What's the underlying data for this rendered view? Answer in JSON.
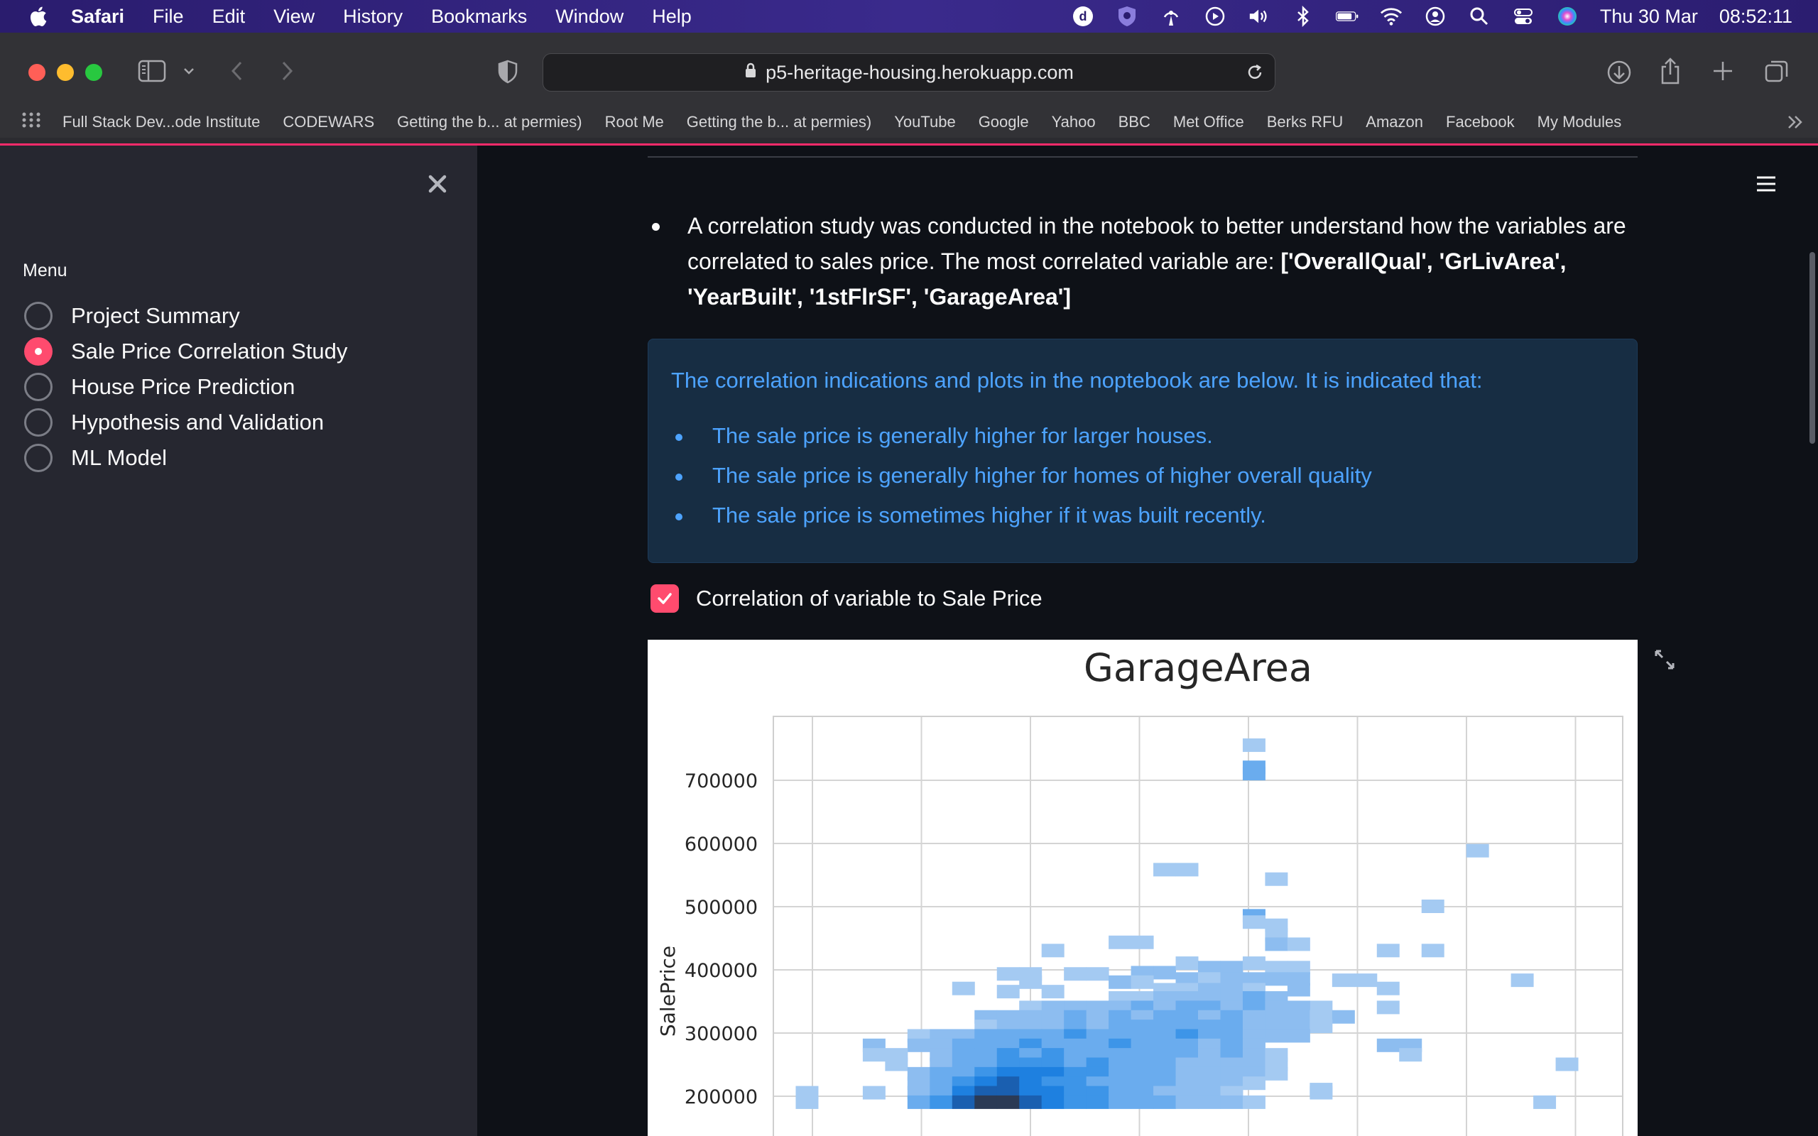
{
  "menubar": {
    "app": "Safari",
    "items": [
      "File",
      "Edit",
      "View",
      "History",
      "Bookmarks",
      "Window",
      "Help"
    ],
    "date": "Thu 30 Mar",
    "time": "08:52:11"
  },
  "browser": {
    "url": "p5-heritage-housing.herokuapp.com",
    "bookmarks": [
      "Full Stack Dev...ode Institute",
      "CODEWARS",
      "Getting the b... at permies)",
      "Root Me",
      "Getting the b... at permies)",
      "YouTube",
      "Google",
      "Yahoo",
      "BBC",
      "Met Office",
      "Berks RFU",
      "Amazon",
      "Facebook",
      "My Modules"
    ]
  },
  "sidebar": {
    "menu_title": "Menu",
    "items": [
      {
        "label": "Project Summary",
        "selected": false
      },
      {
        "label": "Sale Price Correlation Study",
        "selected": true
      },
      {
        "label": "House Price Prediction",
        "selected": false
      },
      {
        "label": "Hypothesis and Validation",
        "selected": false
      },
      {
        "label": "ML Model",
        "selected": false
      }
    ]
  },
  "main": {
    "bullet_text": "A correlation study was conducted in the notebook to better understand how the variables are correlated to sales price. The most correlated variable are: ",
    "bullet_bold": "['OverallQual', 'GrLivArea', 'YearBuilt', '1stFlrSF', 'GarageArea']",
    "info_intro": "The correlation indications and plots in the noptebook are below. It is indicated that:",
    "info_items": [
      "The sale price is generally higher for larger houses.",
      "The sale price is generally higher for homes of higher overall quality",
      "The sale price is sometimes higher if it was built recently."
    ],
    "checkbox_label": "Correlation of variable to Sale Price",
    "checkbox_checked": true
  },
  "chart_data": {
    "type": "heatmap",
    "title": "GarageArea",
    "xlabel": "",
    "ylabel": "SalePrice",
    "yticks": [
      200000,
      300000,
      400000,
      500000,
      600000,
      700000
    ],
    "ylim": [
      190000,
      785000
    ],
    "x_bins": 38,
    "cells": [
      [
        21,
        755000,
        0.35
      ],
      [
        21,
        720000,
        0.5
      ],
      [
        21,
        710000,
        0.5
      ],
      [
        31,
        588000,
        0.35
      ],
      [
        17,
        558000,
        0.35
      ],
      [
        18,
        558000,
        0.35
      ],
      [
        22,
        543000,
        0.35
      ],
      [
        21,
        485000,
        0.5
      ],
      [
        21,
        475000,
        0.35
      ],
      [
        22,
        470000,
        0.35
      ],
      [
        22,
        455000,
        0.35
      ],
      [
        22,
        440000,
        0.45
      ],
      [
        23,
        440000,
        0.35
      ],
      [
        29,
        500000,
        0.35
      ],
      [
        15,
        443000,
        0.35
      ],
      [
        16,
        443000,
        0.35
      ],
      [
        12,
        430000,
        0.35
      ],
      [
        27,
        430000,
        0.35
      ],
      [
        29,
        430000,
        0.35
      ],
      [
        33,
        383000,
        0.35
      ],
      [
        25,
        383000,
        0.35
      ],
      [
        26,
        383000,
        0.35
      ],
      [
        8,
        370000,
        0.35
      ],
      [
        27,
        370000,
        0.35
      ],
      [
        27,
        340000,
        0.35
      ],
      [
        24,
        340000,
        0.35
      ],
      [
        10,
        393000,
        0.35
      ],
      [
        11,
        393000,
        0.35
      ],
      [
        13,
        393000,
        0.35
      ],
      [
        14,
        393000,
        0.35
      ],
      [
        16,
        395000,
        0.4
      ],
      [
        17,
        395000,
        0.4
      ],
      [
        18,
        410000,
        0.35
      ],
      [
        19,
        403000,
        0.4
      ],
      [
        20,
        403000,
        0.4
      ],
      [
        21,
        410000,
        0.35
      ],
      [
        22,
        403000,
        0.35
      ],
      [
        23,
        403000,
        0.35
      ],
      [
        11,
        380000,
        0.35
      ],
      [
        15,
        380000,
        0.4
      ],
      [
        16,
        380000,
        0.35
      ],
      [
        18,
        385000,
        0.4
      ],
      [
        19,
        385000,
        0.35
      ],
      [
        20,
        385000,
        0.45
      ],
      [
        21,
        385000,
        0.4
      ],
      [
        22,
        385000,
        0.4
      ],
      [
        23,
        385000,
        0.4
      ],
      [
        10,
        365000,
        0.35
      ],
      [
        12,
        365000,
        0.35
      ],
      [
        17,
        368000,
        0.35
      ],
      [
        18,
        368000,
        0.35
      ],
      [
        19,
        368000,
        0.4
      ],
      [
        20,
        368000,
        0.4
      ],
      [
        21,
        368000,
        0.35
      ],
      [
        23,
        368000,
        0.4
      ],
      [
        15,
        355000,
        0.35
      ],
      [
        16,
        355000,
        0.35
      ],
      [
        17,
        355000,
        0.4
      ],
      [
        18,
        355000,
        0.4
      ],
      [
        19,
        355000,
        0.45
      ],
      [
        20,
        355000,
        0.4
      ],
      [
        21,
        355000,
        0.5
      ],
      [
        22,
        355000,
        0.45
      ],
      [
        11,
        340000,
        0.35
      ],
      [
        12,
        340000,
        0.4
      ],
      [
        13,
        340000,
        0.45
      ],
      [
        14,
        340000,
        0.4
      ],
      [
        15,
        340000,
        0.45
      ],
      [
        16,
        340000,
        0.5
      ],
      [
        17,
        340000,
        0.45
      ],
      [
        18,
        340000,
        0.55
      ],
      [
        19,
        340000,
        0.5
      ],
      [
        20,
        340000,
        0.45
      ],
      [
        21,
        340000,
        0.5
      ],
      [
        22,
        340000,
        0.4
      ],
      [
        23,
        340000,
        0.4
      ],
      [
        9,
        325000,
        0.4
      ],
      [
        10,
        325000,
        0.4
      ],
      [
        11,
        325000,
        0.45
      ],
      [
        12,
        325000,
        0.4
      ],
      [
        13,
        325000,
        0.5
      ],
      [
        14,
        325000,
        0.45
      ],
      [
        15,
        325000,
        0.5
      ],
      [
        16,
        325000,
        0.45
      ],
      [
        17,
        325000,
        0.5
      ],
      [
        18,
        325000,
        0.55
      ],
      [
        19,
        325000,
        0.45
      ],
      [
        20,
        325000,
        0.5
      ],
      [
        21,
        325000,
        0.45
      ],
      [
        22,
        325000,
        0.45
      ],
      [
        23,
        325000,
        0.4
      ],
      [
        24,
        325000,
        0.35
      ],
      [
        25,
        325000,
        0.4
      ],
      [
        9,
        310000,
        0.35
      ],
      [
        10,
        310000,
        0.45
      ],
      [
        11,
        310000,
        0.4
      ],
      [
        12,
        310000,
        0.45
      ],
      [
        13,
        310000,
        0.5
      ],
      [
        14,
        310000,
        0.45
      ],
      [
        15,
        310000,
        0.5
      ],
      [
        16,
        310000,
        0.55
      ],
      [
        17,
        310000,
        0.5
      ],
      [
        18,
        310000,
        0.5
      ],
      [
        19,
        310000,
        0.55
      ],
      [
        20,
        310000,
        0.5
      ],
      [
        21,
        310000,
        0.45
      ],
      [
        22,
        310000,
        0.4
      ],
      [
        23,
        310000,
        0.45
      ],
      [
        24,
        310000,
        0.35
      ],
      [
        6,
        295000,
        0.35
      ],
      [
        7,
        295000,
        0.4
      ],
      [
        8,
        295000,
        0.45
      ],
      [
        9,
        295000,
        0.5
      ],
      [
        10,
        295000,
        0.5
      ],
      [
        11,
        295000,
        0.55
      ],
      [
        12,
        295000,
        0.5
      ],
      [
        13,
        295000,
        0.6
      ],
      [
        14,
        295000,
        0.55
      ],
      [
        15,
        295000,
        0.5
      ],
      [
        16,
        295000,
        0.55
      ],
      [
        17,
        295000,
        0.5
      ],
      [
        18,
        295000,
        0.6
      ],
      [
        19,
        295000,
        0.5
      ],
      [
        20,
        295000,
        0.55
      ],
      [
        21,
        295000,
        0.45
      ],
      [
        22,
        295000,
        0.4
      ],
      [
        23,
        295000,
        0.4
      ],
      [
        4,
        280000,
        0.4
      ],
      [
        6,
        280000,
        0.4
      ],
      [
        7,
        280000,
        0.45
      ],
      [
        8,
        280000,
        0.5
      ],
      [
        9,
        280000,
        0.55
      ],
      [
        10,
        280000,
        0.5
      ],
      [
        11,
        280000,
        0.6
      ],
      [
        12,
        280000,
        0.55
      ],
      [
        13,
        280000,
        0.5
      ],
      [
        14,
        280000,
        0.55
      ],
      [
        15,
        280000,
        0.6
      ],
      [
        16,
        280000,
        0.5
      ],
      [
        17,
        280000,
        0.55
      ],
      [
        18,
        280000,
        0.5
      ],
      [
        19,
        280000,
        0.45
      ],
      [
        20,
        280000,
        0.5
      ],
      [
        21,
        280000,
        0.45
      ],
      [
        27,
        280000,
        0.4
      ],
      [
        28,
        280000,
        0.4
      ],
      [
        4,
        265000,
        0.35
      ],
      [
        5,
        265000,
        0.35
      ],
      [
        7,
        265000,
        0.45
      ],
      [
        8,
        265000,
        0.5
      ],
      [
        9,
        265000,
        0.55
      ],
      [
        10,
        265000,
        0.6
      ],
      [
        11,
        265000,
        0.55
      ],
      [
        12,
        265000,
        0.6
      ],
      [
        13,
        265000,
        0.55
      ],
      [
        14,
        265000,
        0.5
      ],
      [
        15,
        265000,
        0.55
      ],
      [
        16,
        265000,
        0.5
      ],
      [
        17,
        265000,
        0.55
      ],
      [
        18,
        265000,
        0.5
      ],
      [
        19,
        265000,
        0.45
      ],
      [
        20,
        265000,
        0.5
      ],
      [
        21,
        265000,
        0.4
      ],
      [
        22,
        265000,
        0.35
      ],
      [
        28,
        265000,
        0.35
      ],
      [
        5,
        250000,
        0.35
      ],
      [
        7,
        250000,
        0.45
      ],
      [
        8,
        250000,
        0.5
      ],
      [
        9,
        250000,
        0.55
      ],
      [
        10,
        250000,
        0.6
      ],
      [
        11,
        250000,
        0.65
      ],
      [
        12,
        250000,
        0.6
      ],
      [
        13,
        250000,
        0.55
      ],
      [
        14,
        250000,
        0.6
      ],
      [
        15,
        250000,
        0.55
      ],
      [
        16,
        250000,
        0.5
      ],
      [
        17,
        250000,
        0.55
      ],
      [
        18,
        250000,
        0.45
      ],
      [
        19,
        250000,
        0.45
      ],
      [
        20,
        250000,
        0.4
      ],
      [
        21,
        250000,
        0.45
      ],
      [
        22,
        250000,
        0.35
      ],
      [
        35,
        250000,
        0.35
      ],
      [
        6,
        235000,
        0.4
      ],
      [
        7,
        235000,
        0.5
      ],
      [
        8,
        235000,
        0.55
      ],
      [
        9,
        235000,
        0.6
      ],
      [
        10,
        235000,
        0.7
      ],
      [
        11,
        235000,
        0.75
      ],
      [
        12,
        235000,
        0.7
      ],
      [
        13,
        235000,
        0.6
      ],
      [
        14,
        235000,
        0.6
      ],
      [
        15,
        235000,
        0.55
      ],
      [
        16,
        235000,
        0.5
      ],
      [
        17,
        235000,
        0.5
      ],
      [
        18,
        235000,
        0.45
      ],
      [
        19,
        235000,
        0.45
      ],
      [
        20,
        235000,
        0.4
      ],
      [
        21,
        235000,
        0.4
      ],
      [
        22,
        235000,
        0.35
      ],
      [
        1,
        205000,
        0.35
      ],
      [
        6,
        220000,
        0.4
      ],
      [
        7,
        220000,
        0.5
      ],
      [
        8,
        220000,
        0.6
      ],
      [
        9,
        220000,
        0.75
      ],
      [
        10,
        220000,
        0.8
      ],
      [
        11,
        220000,
        0.7
      ],
      [
        12,
        220000,
        0.65
      ],
      [
        13,
        220000,
        0.6
      ],
      [
        14,
        220000,
        0.55
      ],
      [
        15,
        220000,
        0.5
      ],
      [
        16,
        220000,
        0.55
      ],
      [
        17,
        220000,
        0.5
      ],
      [
        18,
        220000,
        0.45
      ],
      [
        19,
        220000,
        0.4
      ],
      [
        20,
        220000,
        0.45
      ],
      [
        21,
        220000,
        0.35
      ],
      [
        24,
        210000,
        0.35
      ],
      [
        4,
        205000,
        0.35
      ],
      [
        6,
        205000,
        0.45
      ],
      [
        7,
        205000,
        0.55
      ],
      [
        8,
        205000,
        0.7
      ],
      [
        9,
        205000,
        0.85
      ],
      [
        10,
        205000,
        0.85
      ],
      [
        11,
        205000,
        0.75
      ],
      [
        12,
        205000,
        0.7
      ],
      [
        13,
        205000,
        0.65
      ],
      [
        14,
        205000,
        0.6
      ],
      [
        15,
        205000,
        0.55
      ],
      [
        16,
        205000,
        0.5
      ],
      [
        17,
        205000,
        0.45
      ],
      [
        18,
        205000,
        0.45
      ],
      [
        19,
        205000,
        0.4
      ],
      [
        20,
        205000,
        0.35
      ],
      [
        24,
        205000,
        0.35
      ],
      [
        1,
        190000,
        0.35
      ],
      [
        6,
        190000,
        0.5
      ],
      [
        7,
        190000,
        0.65
      ],
      [
        8,
        190000,
        0.85
      ],
      [
        9,
        190000,
        1.0
      ],
      [
        10,
        190000,
        0.95
      ],
      [
        11,
        190000,
        0.8
      ],
      [
        12,
        190000,
        0.7
      ],
      [
        13,
        190000,
        0.65
      ],
      [
        14,
        190000,
        0.6
      ],
      [
        15,
        190000,
        0.55
      ],
      [
        16,
        190000,
        0.5
      ],
      [
        17,
        190000,
        0.5
      ],
      [
        18,
        190000,
        0.45
      ],
      [
        19,
        190000,
        0.4
      ],
      [
        20,
        190000,
        0.4
      ],
      [
        21,
        190000,
        0.35
      ],
      [
        34,
        190000,
        0.35
      ]
    ]
  }
}
